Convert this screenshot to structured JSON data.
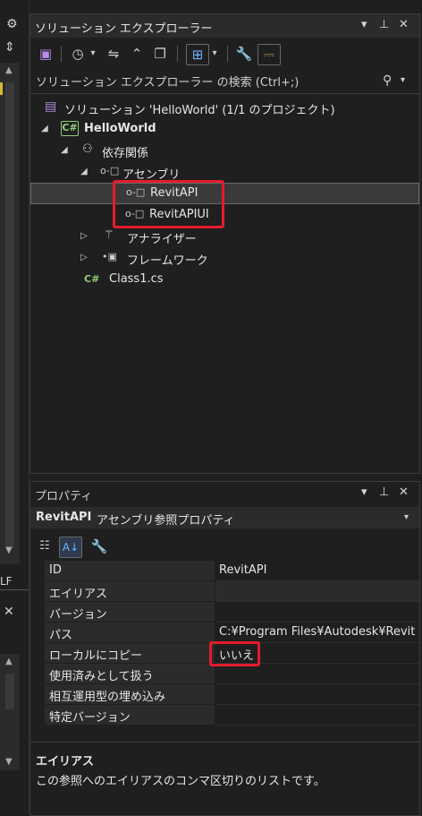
{
  "left_strip": {
    "bottom_label": "LF"
  },
  "solution_explorer": {
    "title": "ソリューション エクスプローラー",
    "search": {
      "placeholder": "ソリューション エクスプローラー の検索 (Ctrl+;)"
    },
    "tree": {
      "solution": "ソリューション 'HelloWorld' (1/1 のプロジェクト)",
      "project": "HelloWorld",
      "dependencies": "依存関係",
      "assemblies": "アセンブリ",
      "assembly_items": [
        "RevitAPI",
        "RevitAPIUI"
      ],
      "analyzers": "アナライザー",
      "frameworks": "フレームワーク",
      "file": "Class1.cs"
    },
    "icons": {
      "project_badge": "C#",
      "file_badge": "C#"
    }
  },
  "properties": {
    "title": "プロパティ",
    "object_name": "RevitAPI",
    "object_type": "アセンブリ参照プロパティ",
    "rows": [
      {
        "name": "ID",
        "value": "RevitAPI"
      },
      {
        "name": "エイリアス",
        "value": ""
      },
      {
        "name": "バージョン",
        "value": ""
      },
      {
        "name": "パス",
        "value": "C:¥Program Files¥Autodesk¥Revit"
      },
      {
        "name": "ローカルにコピー",
        "value": "いいえ"
      },
      {
        "name": "使用済みとして扱う",
        "value": ""
      },
      {
        "name": "相互運用型の埋め込み",
        "value": ""
      },
      {
        "name": "特定バージョン",
        "value": ""
      }
    ],
    "description": {
      "title": "エイリアス",
      "text": "この参照へのエイリアスのコンマ区切りのリストです。"
    }
  },
  "colors": {
    "background": "#1f1f1f",
    "panel_header": "#2b2b2b",
    "selection": "#3a3a3a",
    "highlight_box": "#e41c2b",
    "csharp_badge": "#8fce77"
  }
}
